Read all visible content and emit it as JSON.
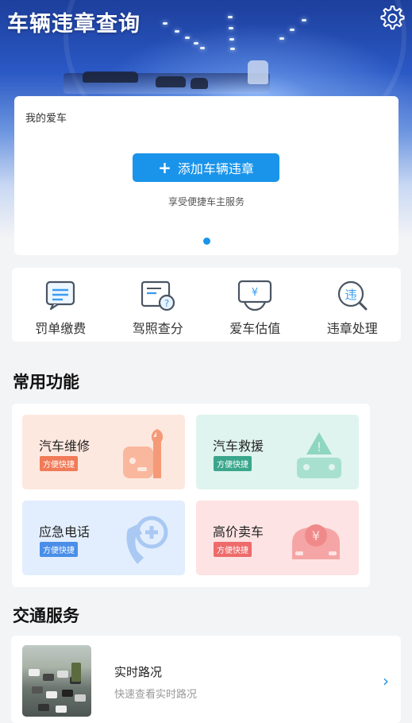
{
  "header": {
    "title": "车辆违章查询"
  },
  "car_card": {
    "label": "我的爱车",
    "add_button": "添加车辆违章",
    "subtitle": "享受便捷车主服务"
  },
  "quick_actions": [
    {
      "label": "罚单缴费",
      "icon": "ticket-chat-icon"
    },
    {
      "label": "驾照查分",
      "icon": "license-check-icon"
    },
    {
      "label": "爱车估值",
      "icon": "valuation-yuan-icon"
    },
    {
      "label": "违章处理",
      "icon": "violation-search-icon"
    }
  ],
  "common": {
    "title": "常用功能",
    "items": [
      {
        "title": "汽车维修",
        "badge": "方便快捷",
        "icon": "repair-wrench-car-icon",
        "bg": "#fde8df",
        "badge_color": "#f07b58"
      },
      {
        "title": "汽车救援",
        "badge": "方便快捷",
        "icon": "rescue-warning-car-icon",
        "bg": "#dff4ee",
        "badge_color": "#3aa68c"
      },
      {
        "title": "应急电话",
        "badge": "方便快捷",
        "icon": "emergency-phone-icon",
        "bg": "#e2eefe",
        "badge_color": "#4a8ee8"
      },
      {
        "title": "高价卖车",
        "badge": "方便快捷",
        "icon": "sell-car-yuan-icon",
        "bg": "#fde3e3",
        "badge_color": "#ee6b6b"
      }
    ]
  },
  "traffic": {
    "title": "交通服务",
    "item": {
      "title": "实时路况",
      "subtitle": "快速查看实时路况"
    }
  },
  "colors": {
    "accent": "#1a94ea"
  }
}
